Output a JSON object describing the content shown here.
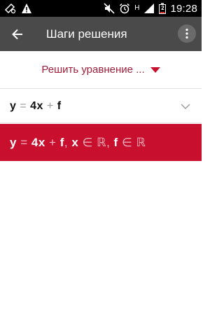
{
  "status_bar": {
    "time": "19:28",
    "network_type": "H",
    "battery_percent": "2",
    "icons": [
      "signal-bars-icon",
      "sim-icon",
      "warning-icon",
      "mute-icon",
      "alarm-icon",
      "battery-icon"
    ]
  },
  "app_bar": {
    "title": "Шаги решения",
    "icons": [
      "back-arrow-icon",
      "more-vert-icon"
    ]
  },
  "method_select": {
    "selected": "Решить уравнение ..."
  },
  "input": {
    "expression_tokens": [
      "y",
      "=",
      "4x",
      "+",
      "f"
    ]
  },
  "result": {
    "expression_tokens": [
      "y",
      "=",
      "4x",
      "+",
      "f",
      ",",
      "x",
      "∈",
      "ℝ",
      ",",
      "f",
      "∈",
      "ℝ"
    ]
  },
  "colors": {
    "status_bar": "#000000",
    "app_bar": "#4a4a4a",
    "accent": "#c8102e",
    "dropdown_text": "#a01e3c"
  }
}
